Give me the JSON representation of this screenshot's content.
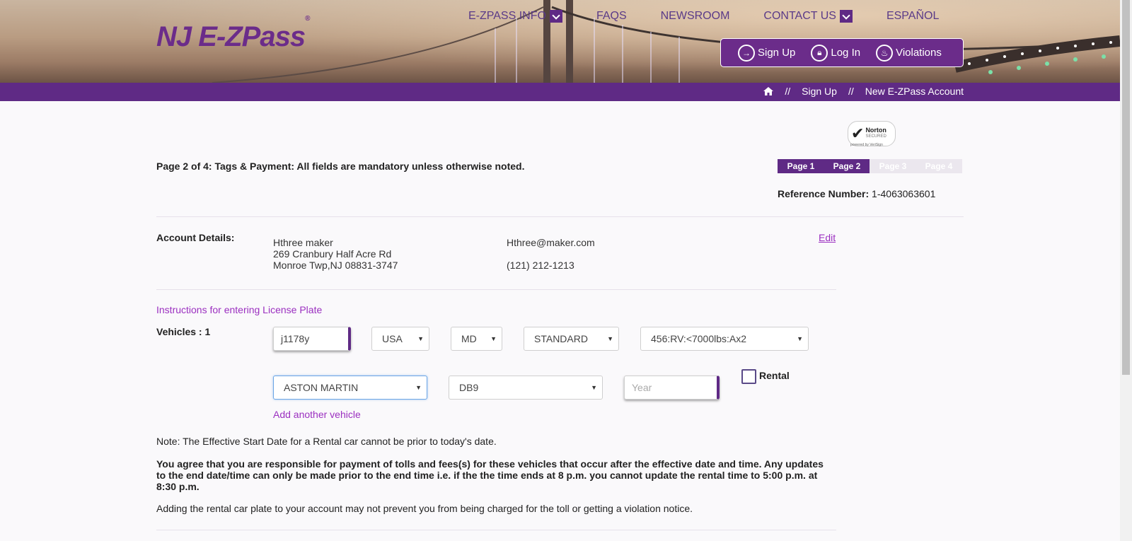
{
  "header": {
    "logo_text": "NJ E-ZPass",
    "logo_mark": "®",
    "nav": [
      {
        "label": "E-ZPASS INFO",
        "dropdown": true
      },
      {
        "label": "FAQS",
        "dropdown": false
      },
      {
        "label": "NEWSROOM",
        "dropdown": false
      },
      {
        "label": "CONTACT US",
        "dropdown": true
      },
      {
        "label": "ESPAÑOL",
        "dropdown": false
      }
    ],
    "account_buttons": [
      {
        "label": "Sign Up",
        "icon": "sign-in-icon"
      },
      {
        "label": "Log In",
        "icon": "lock-icon"
      },
      {
        "label": "Violations",
        "icon": "flame-icon"
      }
    ]
  },
  "breadcrumb": {
    "separator": "//",
    "items": [
      "Sign Up",
      "New E-ZPass Account"
    ]
  },
  "badge": {
    "brand": "Norton",
    "line2": "SECURED",
    "line3": "powered by VeriSign"
  },
  "page": {
    "intro": "Page 2 of 4: Tags & Payment: All fields are mandatory unless otherwise noted.",
    "steps": [
      {
        "label": "Page 1",
        "active": true
      },
      {
        "label": "Page 2",
        "active": true
      },
      {
        "label": "Page 3",
        "active": false
      },
      {
        "label": "Page 4",
        "active": false
      }
    ],
    "reference_label": "Reference Number:",
    "reference_value": "1-4063063601"
  },
  "account": {
    "label": "Account Details:",
    "name": "Hthree maker",
    "address1": "269 Cranbury Half Acre Rd",
    "address2": "Monroe Twp,NJ 08831-3747",
    "email": "Hthree@maker.com",
    "phone": "(121) 212-1213",
    "edit_label": "Edit"
  },
  "vehicles": {
    "instructions_link": "Instructions for entering License Plate",
    "label": "Vehicles : 1",
    "plate_value": "j1178y",
    "country": "USA",
    "state": "MD",
    "plate_type": "STANDARD",
    "vehicle_class": "456:RV:<7000lbs:Ax2",
    "make": "ASTON MARTIN",
    "model": "DB9",
    "year_placeholder": "Year",
    "rental_label": "Rental",
    "add_vehicle_link": "Add another vehicle"
  },
  "notes": {
    "effective_date": "Note: The Effective Start Date for a Rental car cannot be prior to today's date.",
    "agreement": "You agree that you are responsible for payment of tolls and fees(s) for these vehicles that occur after the effective date and time. Any updates to the end date/time can only be made prior to the end time i.e. if the the time ends at 8 p.m. you cannot update the rental time to 5:00 p.m. at 8:30 p.m.",
    "rental_warning": "Adding the rental car plate to your account may not prevent you from being charged for the toll or getting a violation notice."
  },
  "colors": {
    "brand_purple": "#5f2a85",
    "link_purple": "#9b2fc0",
    "focus_blue": "#6ba5e6"
  }
}
